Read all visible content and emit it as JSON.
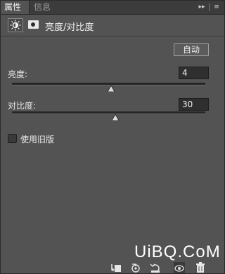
{
  "tabs": [
    {
      "label": "属性",
      "active": true
    },
    {
      "label": "信息",
      "active": false
    }
  ],
  "tab_controls": {
    "collapse_icon": "double-chevron-right-icon",
    "menu_icon": "panel-menu-icon",
    "collapse_glyph": "▸▸",
    "menu_glyph": "≡"
  },
  "header": {
    "title": "亮度/对比度",
    "adjustment_icon": "brightness-icon",
    "mask_icon": "layer-mask-icon"
  },
  "auto_button": {
    "label": "自动"
  },
  "brightness": {
    "label": "亮度:",
    "value": "4",
    "min": -150,
    "max": 150,
    "numeric": 4
  },
  "contrast": {
    "label": "对比度:",
    "value": "30",
    "min": -50,
    "max": 100,
    "numeric": 30
  },
  "legacy": {
    "label": "使用旧版",
    "checked": false
  },
  "watermark": {
    "text": "UiBQ.CoM"
  },
  "toolbar": [
    {
      "icon": "clip-to-layer-icon"
    },
    {
      "icon": "view-previous-state-icon"
    },
    {
      "icon": "reset-adjustment-icon"
    },
    {
      "icon": "toggle-visibility-icon"
    },
    {
      "icon": "delete-icon"
    }
  ],
  "colors": {
    "panel": "#535353",
    "tabbar": "#3c3c3c",
    "input": "#2f2f2f"
  }
}
